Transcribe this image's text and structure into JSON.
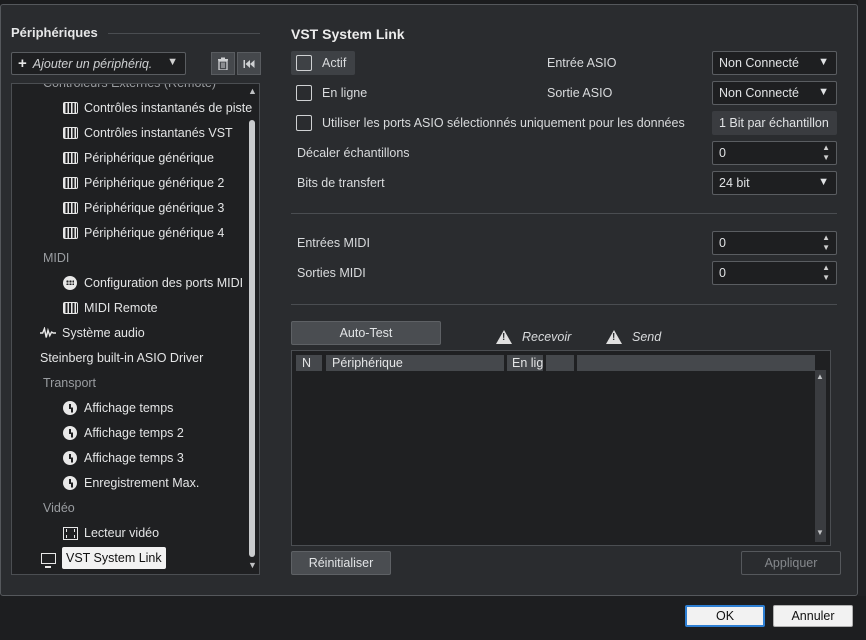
{
  "left_panel": {
    "title": "Périphériques",
    "add_device_label": "Ajouter un périphériq.",
    "tree": [
      {
        "kind": "cat",
        "label": "Contrôleurs Externes (Remote)",
        "icon": ""
      },
      {
        "kind": "item",
        "label": "Contrôles instantanés de piste",
        "icon": "keyboard-icon"
      },
      {
        "kind": "item",
        "label": "Contrôles instantanés VST",
        "icon": "keyboard-icon"
      },
      {
        "kind": "item",
        "label": "Périphérique générique",
        "icon": "keyboard-icon"
      },
      {
        "kind": "item",
        "label": "Périphérique générique 2",
        "icon": "keyboard-icon"
      },
      {
        "kind": "item",
        "label": "Périphérique générique 3",
        "icon": "keyboard-icon"
      },
      {
        "kind": "item",
        "label": "Périphérique générique 4",
        "icon": "keyboard-icon"
      },
      {
        "kind": "cat",
        "label": "MIDI",
        "icon": ""
      },
      {
        "kind": "item",
        "label": "Configuration des ports MIDI",
        "icon": "midi-port-icon"
      },
      {
        "kind": "item",
        "label": "MIDI Remote",
        "icon": "keyboard-icon"
      },
      {
        "kind": "top",
        "label": "Système audio",
        "icon": "waveform-icon"
      },
      {
        "kind": "top",
        "label": "Steinberg built-in ASIO Driver",
        "icon": ""
      },
      {
        "kind": "cat",
        "label": "Transport",
        "icon": ""
      },
      {
        "kind": "item",
        "label": "Affichage temps",
        "icon": "clock-icon"
      },
      {
        "kind": "item",
        "label": "Affichage temps 2",
        "icon": "clock-icon"
      },
      {
        "kind": "item",
        "label": "Affichage temps 3",
        "icon": "clock-icon"
      },
      {
        "kind": "item",
        "label": "Enregistrement Max.",
        "icon": "clock-icon"
      },
      {
        "kind": "cat",
        "label": "Vidéo",
        "icon": ""
      },
      {
        "kind": "item",
        "label": "Lecteur vidéo",
        "icon": "film-icon"
      },
      {
        "kind": "top-sel",
        "label": "VST System Link",
        "icon": "monitor-icon"
      }
    ]
  },
  "right_panel": {
    "title": "VST System Link",
    "actif": "Actif",
    "en_ligne": "En ligne",
    "asio_ports_only": "Utiliser les ports ASIO sélectionnés uniquement pour les données",
    "entree_asio_label": "Entrée ASIO",
    "entree_asio_value": "Non Connecté",
    "sortie_asio_label": "Sortie ASIO",
    "sortie_asio_value": "Non Connecté",
    "bit_label": "1 Bit par échantillon",
    "decaler_label": "Décaler échantillons",
    "decaler_value": "0",
    "bits_label": "Bits de transfert",
    "bits_value": "24 bit",
    "entrees_midi_label": "Entrées MIDI",
    "entrees_midi_value": "0",
    "sorties_midi_label": "Sorties MIDI",
    "sorties_midi_value": "0",
    "autotest": "Auto-Test",
    "recevoir": "Recevoir",
    "send": "Send",
    "table_headers": [
      "N",
      "Périphérique",
      "En lig",
      "",
      ""
    ],
    "reinitialiser": "Réinitialiser",
    "appliquer": "Appliquer"
  },
  "footer": {
    "ok": "OK",
    "annuler": "Annuler"
  }
}
